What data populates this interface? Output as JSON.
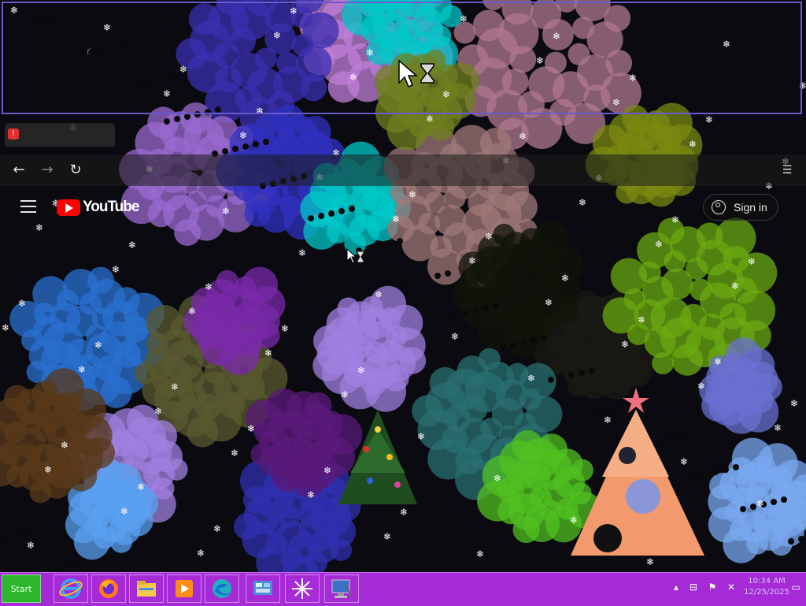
{
  "browser": {
    "tab_badge": "!",
    "nav_back": "←",
    "nav_forward": "→",
    "nav_reload": "↻"
  },
  "youtube": {
    "logo_text": "YouTube",
    "sign_in": "Sign in"
  },
  "taskbar": {
    "start_label": "Start",
    "clock_time": "10:34 AM",
    "clock_date": "12/25/2025",
    "apps": [
      {
        "name": "internet-explorer-icon"
      },
      {
        "name": "firefox-icon"
      },
      {
        "name": "file-explorer-icon"
      },
      {
        "name": "media-player-icon"
      },
      {
        "name": "edge-icon"
      },
      {
        "name": "control-panel-icon"
      },
      {
        "name": "snowflake-app-icon"
      },
      {
        "name": "computer-icon"
      }
    ]
  },
  "colors": {
    "taskbar": "#a62ad6",
    "start_button": "#2db52d",
    "ghost_window_border": "#6a5ad0"
  }
}
